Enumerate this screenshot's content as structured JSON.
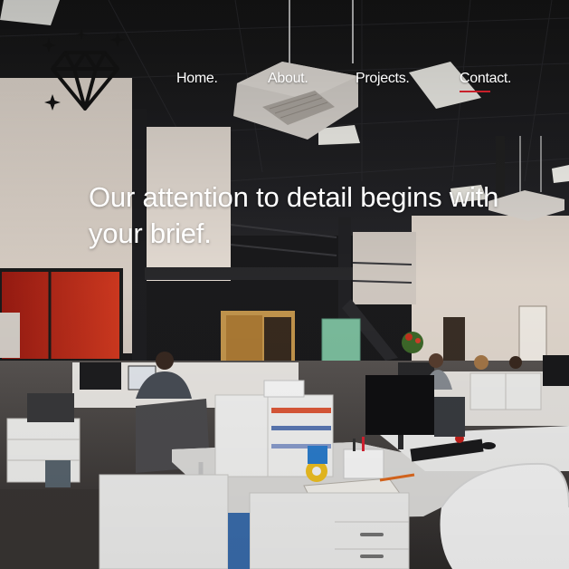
{
  "nav": {
    "items": [
      {
        "label": "Home."
      },
      {
        "label": "About."
      },
      {
        "label": "Projects."
      },
      {
        "label": "Contact."
      }
    ],
    "active_index": 3
  },
  "hero": {
    "headline": "Our attention to detail begins with your brief."
  },
  "logo": {
    "icon": "diamond-icon",
    "accent": "sparkle-icon"
  },
  "colors": {
    "nav_active_underline": "#c8202a",
    "text": "#ffffff",
    "ceiling": "#1b1b1d",
    "wall": "#ece4db",
    "accent_red": "#b81f18"
  }
}
